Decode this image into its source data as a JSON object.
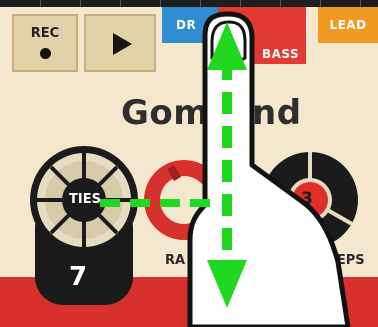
{
  "transport": {
    "rec_label": "REC",
    "record_icon": "record-dot-icon",
    "play_icon": "play-triangle-icon"
  },
  "tabs": [
    {
      "label": "DRUMS",
      "visible_text": "DR",
      "color": "#2f8dd0"
    },
    {
      "label": "BASS",
      "visible_text": "BASS",
      "color": "#e13a33"
    },
    {
      "label": "LEAD",
      "visible_text": "LEAD",
      "color": "#f19a22"
    }
  ],
  "title": {
    "visible_left": "Gomm",
    "visible_right": "nd"
  },
  "ties_knob": {
    "label": "TIES",
    "value": "7"
  },
  "range_knob": {
    "label_visible": "RA"
  },
  "scale_steps_knob": {
    "label": "SCALE STEPS",
    "value": "3"
  },
  "gesture_overlay": {
    "icon": "drag-hand-icon",
    "directions": [
      "up",
      "down",
      "left"
    ]
  },
  "colors": {
    "background": "#f4e7cd",
    "accent_red": "#d8312d",
    "knob_dark": "#1b1b1b",
    "gesture_green": "#1fd81f"
  }
}
